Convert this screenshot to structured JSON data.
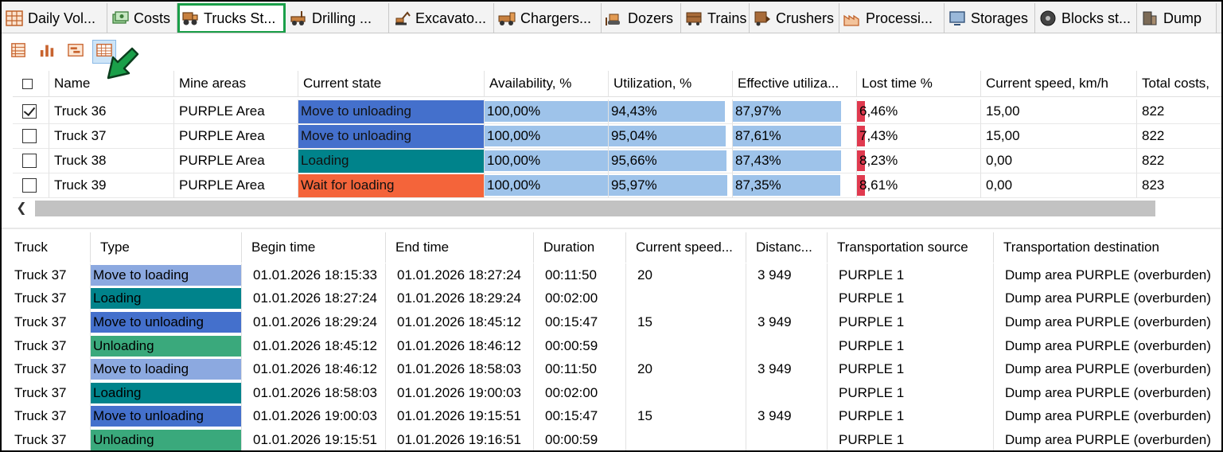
{
  "tabs": [
    {
      "label": "Daily Vol...",
      "icon": "grid-table-icon",
      "width": 133,
      "active": false
    },
    {
      "label": "Costs",
      "icon": "money-stack-icon",
      "width": 88,
      "active": false
    },
    {
      "label": "Trucks St...",
      "icon": "truck-icon",
      "width": 136,
      "active": true
    },
    {
      "label": "Drilling ...",
      "icon": "drilling-rig-icon",
      "width": 130,
      "active": false
    },
    {
      "label": "Excavato...",
      "icon": "excavator-icon",
      "width": 132,
      "active": false
    },
    {
      "label": "Chargers...",
      "icon": "charger-truck-icon",
      "width": 135,
      "active": false
    },
    {
      "label": "Dozers",
      "icon": "dozer-icon",
      "width": 100,
      "active": false
    },
    {
      "label": "Trains",
      "icon": "train-icon",
      "width": 86,
      "active": false
    },
    {
      "label": "Crushers",
      "icon": "crusher-icon",
      "width": 113,
      "active": false
    },
    {
      "label": "Processi...",
      "icon": "factory-icon",
      "width": 132,
      "active": false
    },
    {
      "label": "Storages",
      "icon": "storage-monitor-icon",
      "width": 114,
      "active": false
    },
    {
      "label": "Blocks st...",
      "icon": "blocks-disc-icon",
      "width": 128,
      "active": false
    },
    {
      "label": "Dump",
      "icon": "dump-icon",
      "width": 100,
      "active": false
    }
  ],
  "toolbar": [
    {
      "name": "table-view-icon",
      "active": false
    },
    {
      "name": "bar-chart-icon",
      "active": false
    },
    {
      "name": "gantt-view-icon",
      "active": false
    },
    {
      "name": "detail-grid-icon",
      "active": true
    }
  ],
  "colors": {
    "move_to_unloading": "#4470cc",
    "move_to_loading": "#8ca9e0",
    "loading": "#00838b",
    "unloading": "#3aa97c",
    "wait_for_loading": "#f4643a",
    "percent_bar": "#9ec3ea",
    "lost_bar": "#e03a4f",
    "accent": "#1a9f49"
  },
  "trucks_table": {
    "columns": [
      {
        "label": "",
        "width": 46
      },
      {
        "label": "Name",
        "width": 157
      },
      {
        "label": "Mine areas",
        "width": 156
      },
      {
        "label": "Current state",
        "width": 234
      },
      {
        "label": "Availability, %",
        "width": 156
      },
      {
        "label": "Utilization, %",
        "width": 156
      },
      {
        "label": "Effective utiliza...",
        "width": 156
      },
      {
        "label": "Lost time %",
        "width": 156
      },
      {
        "label": "Current speed, km/h",
        "width": 196
      },
      {
        "label": "Total costs,",
        "width": 110
      }
    ],
    "rows": [
      {
        "checked": true,
        "name": "Truck 36",
        "area": "PURPLE Area",
        "state": "Move to unloading",
        "state_key": "move_to_unloading",
        "availability": "100,00%",
        "availability_val": 100.0,
        "utilization": "94,43%",
        "utilization_val": 94.43,
        "effective": "87,97%",
        "effective_val": 87.97,
        "lost": "6,46%",
        "lost_val": 6.46,
        "speed": "15,00",
        "costs": "822"
      },
      {
        "checked": false,
        "name": "Truck 37",
        "area": "PURPLE Area",
        "state": "Move to unloading",
        "state_key": "move_to_unloading",
        "availability": "100,00%",
        "availability_val": 100.0,
        "utilization": "95,04%",
        "utilization_val": 95.04,
        "effective": "87,61%",
        "effective_val": 87.61,
        "lost": "7,43%",
        "lost_val": 7.43,
        "speed": "15,00",
        "costs": "822"
      },
      {
        "checked": false,
        "name": "Truck 38",
        "area": "PURPLE Area",
        "state": "Loading",
        "state_key": "loading",
        "availability": "100,00%",
        "availability_val": 100.0,
        "utilization": "95,66%",
        "utilization_val": 95.66,
        "effective": "87,43%",
        "effective_val": 87.43,
        "lost": "8,23%",
        "lost_val": 8.23,
        "speed": "0,00",
        "costs": "822"
      },
      {
        "checked": false,
        "name": "Truck 39",
        "area": "PURPLE Area",
        "state": "Wait for loading",
        "state_key": "wait_for_loading",
        "availability": "100,00%",
        "availability_val": 100.0,
        "utilization": "95,97%",
        "utilization_val": 95.97,
        "effective": "87,35%",
        "effective_val": 87.35,
        "lost": "8,61%",
        "lost_val": 8.61,
        "speed": "0,00",
        "costs": "823"
      }
    ]
  },
  "states_table": {
    "columns": [
      {
        "label": "Truck",
        "width": 98
      },
      {
        "label": "Type",
        "width": 190
      },
      {
        "label": "Begin time",
        "width": 181
      },
      {
        "label": "End time",
        "width": 186
      },
      {
        "label": "Duration",
        "width": 116
      },
      {
        "label": "Current speed...",
        "width": 151
      },
      {
        "label": "Distanc...",
        "width": 102
      },
      {
        "label": "Transportation source",
        "width": 209
      },
      {
        "label": "Transportation destination",
        "width": 290
      }
    ],
    "rows": [
      {
        "truck": "Truck 37",
        "type": "Move to loading",
        "type_key": "move_to_loading",
        "begin": "01.01.2026 18:15:33",
        "end": "01.01.2026 18:27:24",
        "duration": "00:11:50",
        "speed": "20",
        "distance": "3 949",
        "source": "PURPLE 1",
        "destination": "Dump area PURPLE (overburden)"
      },
      {
        "truck": "Truck 37",
        "type": "Loading",
        "type_key": "loading",
        "begin": "01.01.2026 18:27:24",
        "end": "01.01.2026 18:29:24",
        "duration": "00:02:00",
        "speed": "",
        "distance": "",
        "source": "PURPLE 1",
        "destination": "Dump area PURPLE (overburden)"
      },
      {
        "truck": "Truck 37",
        "type": "Move to unloading",
        "type_key": "move_to_unloading",
        "begin": "01.01.2026 18:29:24",
        "end": "01.01.2026 18:45:12",
        "duration": "00:15:47",
        "speed": "15",
        "distance": "3 949",
        "source": "PURPLE 1",
        "destination": "Dump area PURPLE (overburden)"
      },
      {
        "truck": "Truck 37",
        "type": "Unloading",
        "type_key": "unloading",
        "begin": "01.01.2026 18:45:12",
        "end": "01.01.2026 18:46:12",
        "duration": "00:00:59",
        "speed": "",
        "distance": "",
        "source": "PURPLE 1",
        "destination": "Dump area PURPLE (overburden)"
      },
      {
        "truck": "Truck 37",
        "type": "Move to loading",
        "type_key": "move_to_loading",
        "begin": "01.01.2026 18:46:12",
        "end": "01.01.2026 18:58:03",
        "duration": "00:11:50",
        "speed": "20",
        "distance": "3 949",
        "source": "PURPLE 1",
        "destination": "Dump area PURPLE (overburden)"
      },
      {
        "truck": "Truck 37",
        "type": "Loading",
        "type_key": "loading",
        "begin": "01.01.2026 18:58:03",
        "end": "01.01.2026 19:00:03",
        "duration": "00:02:00",
        "speed": "",
        "distance": "",
        "source": "PURPLE 1",
        "destination": "Dump area PURPLE (overburden)"
      },
      {
        "truck": "Truck 37",
        "type": "Move to unloading",
        "type_key": "move_to_unloading",
        "begin": "01.01.2026 19:00:03",
        "end": "01.01.2026 19:15:51",
        "duration": "00:15:47",
        "speed": "15",
        "distance": "3 949",
        "source": "PURPLE 1",
        "destination": "Dump area PURPLE (overburden)"
      },
      {
        "truck": "Truck 37",
        "type": "Unloading",
        "type_key": "unloading",
        "begin": "01.01.2026 19:15:51",
        "end": "01.01.2026 19:16:51",
        "duration": "00:00:59",
        "speed": "",
        "distance": "",
        "source": "PURPLE 1",
        "destination": "Dump area PURPLE (overburden)"
      }
    ]
  }
}
